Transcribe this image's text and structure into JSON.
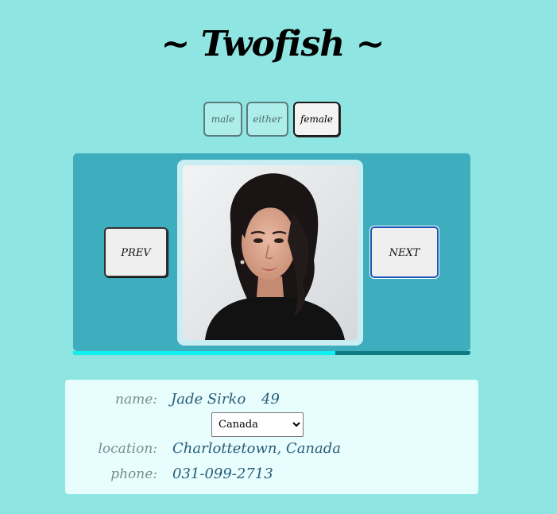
{
  "app": {
    "title": "~ Twofish ~"
  },
  "gender_filter": {
    "options": [
      {
        "label": "male",
        "selected": false
      },
      {
        "label": "either",
        "selected": false
      },
      {
        "label": "female",
        "selected": true
      }
    ]
  },
  "carousel": {
    "prev_label": "PREV",
    "next_label": "NEXT",
    "progress_fraction": 0.66,
    "photo_alt": "Profile photo"
  },
  "profile": {
    "name_label": "name:",
    "name": "Jade Sirko",
    "age": "49",
    "country_selected": "Canada",
    "country_options": [
      "Canada"
    ],
    "location_label": "location:",
    "location": "Charlottetown, Canada",
    "phone_label": "phone:",
    "phone": "031-099-2713"
  },
  "colors": {
    "background": "#8ee5e2",
    "panel": "#3eaebe",
    "progress_fill": "#10f0f0",
    "card": "#e7fdfe"
  }
}
